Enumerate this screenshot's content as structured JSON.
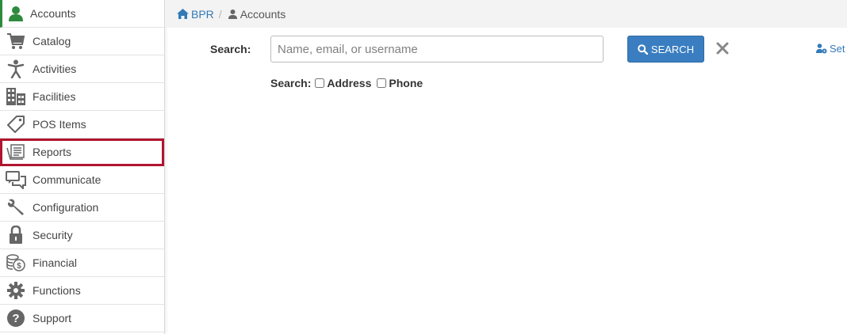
{
  "sidebar": {
    "items": [
      {
        "label": "Accounts",
        "icon": "person-icon"
      },
      {
        "label": "Catalog",
        "icon": "cart-icon"
      },
      {
        "label": "Activities",
        "icon": "activity-person-icon"
      },
      {
        "label": "Facilities",
        "icon": "building-icon"
      },
      {
        "label": "POS Items",
        "icon": "tag-icon"
      },
      {
        "label": "Reports",
        "icon": "reports-icon"
      },
      {
        "label": "Communicate",
        "icon": "chat-icon"
      },
      {
        "label": "Configuration",
        "icon": "wrench-icon"
      },
      {
        "label": "Security",
        "icon": "lock-icon"
      },
      {
        "label": "Financial",
        "icon": "coins-icon"
      },
      {
        "label": "Functions",
        "icon": "gear-icon"
      },
      {
        "label": "Support",
        "icon": "question-icon"
      }
    ],
    "active_item": "Accounts",
    "highlighted_item": "Reports",
    "active_color": "#2e8b3e",
    "highlight_color": "#b0152f"
  },
  "breadcrumb": {
    "home_label": "BPR",
    "separator": "/",
    "current_label": "Accounts"
  },
  "search": {
    "label": "Search:",
    "placeholder": "Name, email, or username",
    "value": "",
    "button_label": "SEARCH",
    "button_color": "#3a7ec1",
    "settings_label": "Set",
    "options_label": "Search:",
    "options": [
      {
        "label": "Address",
        "checked": false
      },
      {
        "label": "Phone",
        "checked": false
      }
    ]
  }
}
